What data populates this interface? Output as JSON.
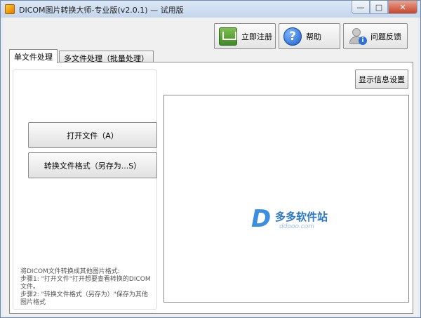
{
  "window": {
    "title": "DICOM图片转换大师-专业版(v2.0.1) — 试用版",
    "minimize": "—",
    "maximize": "□",
    "close": "✕"
  },
  "toolbar": {
    "register_label": "立即注册",
    "help_label": "帮助",
    "feedback_label": "问题反馈",
    "help_glyph": "?",
    "info_glyph": "i"
  },
  "tabs": [
    {
      "label": "单文件处理",
      "active": true
    },
    {
      "label": "多文件处理（批量处理）",
      "active": false
    }
  ],
  "single": {
    "open_button": "打开文件（A）",
    "convert_button": "转换文件格式（另存为...S）",
    "hint_lines": [
      "将DICOM文件转换成其他图片格式:",
      "  步骤1: \"打开文件\"打开想要查看转换的DICOM文件。",
      "  步骤2: \"转换文件格式（另存为）\"保存为其他图片格式"
    ]
  },
  "display_settings_button": "显示信息设置",
  "watermark": {
    "letter": "D",
    "name": "多多软件站",
    "domain": "ddooo.com"
  },
  "colors": {
    "accent": "#3b8fe0"
  }
}
